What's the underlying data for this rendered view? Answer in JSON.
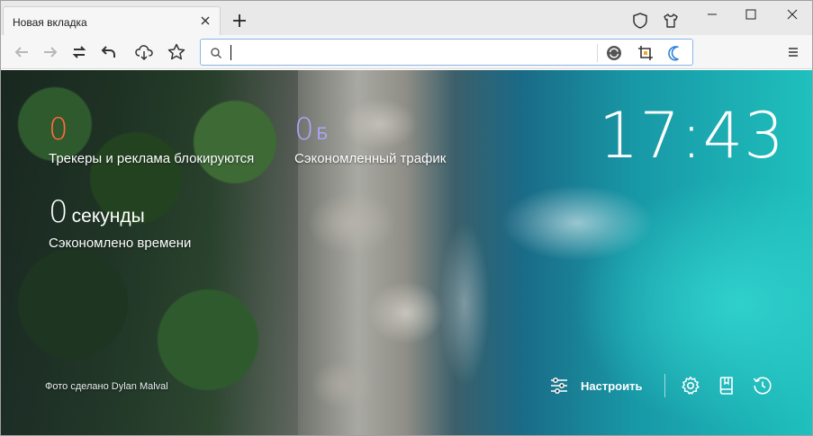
{
  "window": {
    "tab_title": "Новая вкладка"
  },
  "toolbar": {
    "address_value": "",
    "address_placeholder": ""
  },
  "stats": {
    "trackers_value": "0",
    "trackers_label": "Трекеры и реклама блокируются",
    "traffic_value": "0",
    "traffic_unit": "Б",
    "traffic_label": "Сэкономленный трафик",
    "time_value": "0",
    "time_unit": "секунды",
    "time_label": "Сэкономлено времени"
  },
  "clock": {
    "time": "17:43"
  },
  "photo_credit": "Фото сделано Dylan Malval",
  "bottom_bar": {
    "customize_label": "Настроить"
  },
  "colors": {
    "trackers_accent": "#ff6a3d",
    "traffic_accent": "#a9a6ff",
    "address_border": "#8cb4e8"
  },
  "icons": {
    "tab_close": "close-icon",
    "new_tab": "plus-icon",
    "shield": "shield-icon",
    "theme": "tshirt-icon",
    "back": "arrow-left-icon",
    "forward": "arrow-right-icon",
    "sync": "sync-icon",
    "undo": "undo-icon",
    "download": "cloud-download-icon",
    "bookmark": "star-icon",
    "search": "search-icon",
    "translate": "refresh-circle-icon",
    "screenshot": "crop-icon",
    "night_mode": "moon-icon",
    "menu": "menu-icon",
    "customize": "sliders-icon",
    "settings": "gear-icon",
    "bookmarks": "book-icon",
    "history": "history-icon"
  }
}
